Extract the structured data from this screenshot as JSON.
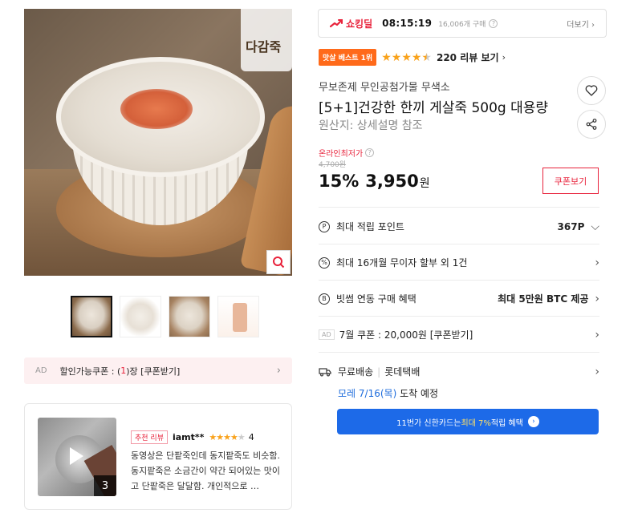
{
  "image": {
    "logo_text": "다감죽",
    "zoom_icon": "magnifier-icon"
  },
  "ad_coupon": {
    "ad_label": "AD",
    "text_before": "할인가능쿠폰 : (",
    "count": "1",
    "text_after": ")장 [쿠폰받기]"
  },
  "review": {
    "media_count": "3",
    "badge": "추천 리뷰",
    "user": "iamt**",
    "rating": 4,
    "rating_label": "4",
    "text": "동영상은 단팥죽인데 동지팥죽도 비슷함. 동지팥죽은 소금간이 약간 되어있는 맛이고 단팥죽은 달달함. 개인적으로 …"
  },
  "shocking_deal": {
    "label": "쇼킹딜",
    "timer": "08:15:19",
    "sold": "16,006개 구매",
    "more": "더보기 ›"
  },
  "rating": {
    "best_badge": "맛살 베스트 1위",
    "stars": 4.5,
    "review_count": "220 리뷰 보기",
    "more_arrow": "›"
  },
  "product": {
    "seller": "무보존제 무인공첨가물 무색소",
    "title": "[5+1]건강한 한끼 게살죽 500g 대용량",
    "origin": "원산지: 상세설명 참조"
  },
  "price": {
    "lowest_label": "온라인최저가",
    "original": "4,700원",
    "discount": "15%",
    "sale": "3,950",
    "unit": "원",
    "coupon_button": "쿠폰보기"
  },
  "info_rows": {
    "points_label": "최대 적립 포인트",
    "points_value": "367P",
    "installment_label": "최대 16개월 무이자 할부 외 1건",
    "btc_label": "빗썸 연동 구매 혜택",
    "btc_value": "최대 5만원 BTC 제공",
    "coupon_ad": "AD",
    "coupon_label": "7월 쿠폰 : 20,000원 [쿠폰받기]"
  },
  "delivery": {
    "type": "무료배송",
    "carrier": "롯데택배",
    "date": "모레 7/16(목)",
    "suffix": " 도착 예정"
  },
  "card_banner": {
    "before": "11번가 신한카드는 ",
    "highlight": "최대 7%",
    "after": " 적립 혜택"
  },
  "colors": {
    "accent_red": "#e8223b",
    "best_orange": "#ff6a1a",
    "star": "#f9a21b",
    "banner_blue": "#1d6ae8",
    "delivery_blue": "#1c6bdc"
  }
}
